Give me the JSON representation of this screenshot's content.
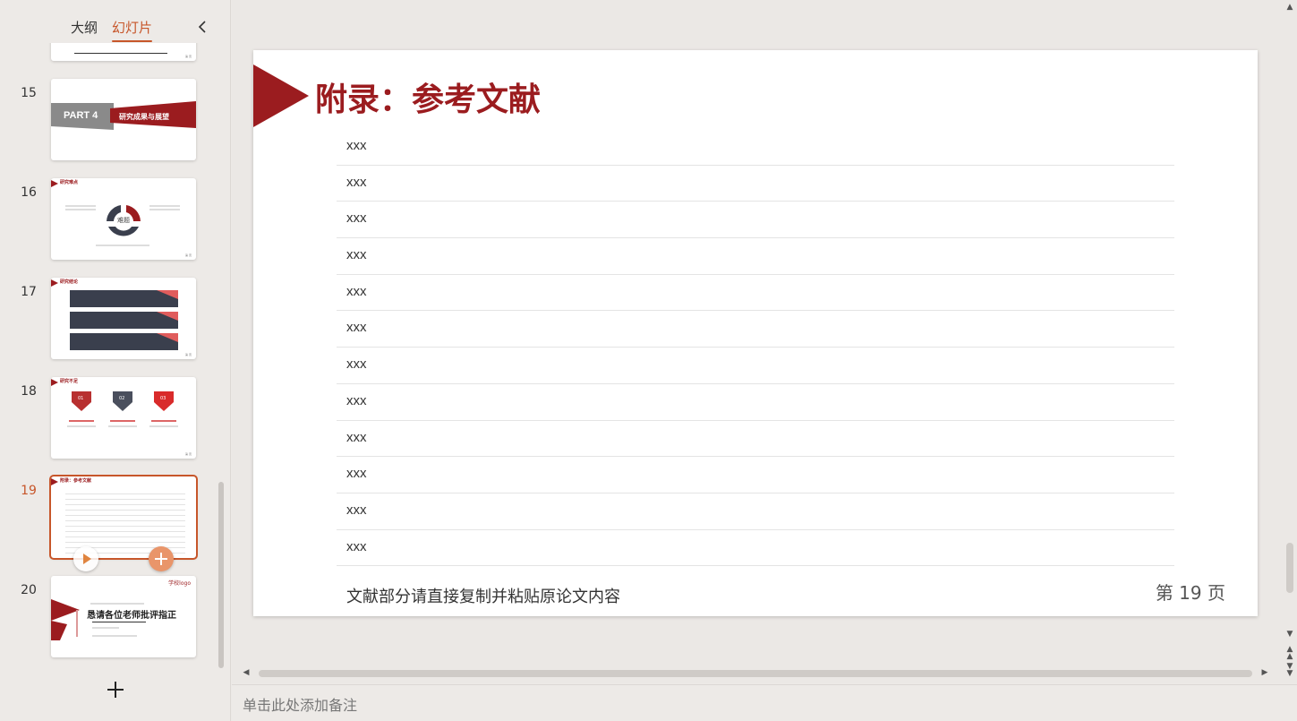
{
  "left_panel": {
    "tabs": {
      "outline": "大纲",
      "slides": "幻灯片"
    },
    "thumbnails": [
      {
        "num": "15",
        "part_label": "PART 4",
        "part_title": "研究成果与展望"
      },
      {
        "num": "16",
        "title": "研究难点",
        "center_label": "难题"
      },
      {
        "num": "17",
        "title": "研究结论"
      },
      {
        "num": "18",
        "title": "研究不足",
        "badges": [
          "01",
          "02",
          "03"
        ]
      },
      {
        "num": "19",
        "title": "附录：参考文献"
      },
      {
        "num": "20",
        "logo": "学校logo",
        "title": "恳请各位老师批评指正"
      }
    ]
  },
  "slide": {
    "title": "附录：参考文献",
    "references": [
      "xxx",
      "xxx",
      "xxx",
      "xxx",
      "xxx",
      "xxx",
      "xxx",
      "xxx",
      "xxx",
      "xxx",
      "xxx",
      "xxx"
    ],
    "note": "文献部分请直接复制并粘贴原论文内容",
    "page_label": "第 19  页"
  },
  "notes": {
    "placeholder": "单击此处添加备注"
  },
  "colors": {
    "accent": "#c7562a",
    "brand_red": "#9b1c1f"
  }
}
